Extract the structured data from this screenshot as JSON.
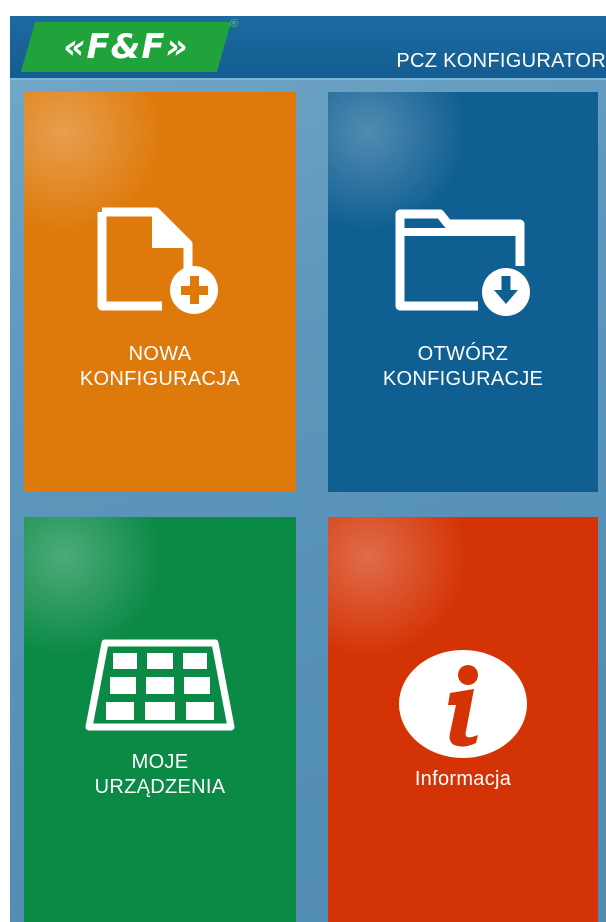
{
  "header": {
    "logo_text": "«F&F»",
    "logo_registered": "®",
    "title": "PCZ KONFIGURATOR"
  },
  "tiles": [
    {
      "id": "new",
      "line1": "NOWA",
      "line2": "KONFIGURACJA",
      "color": "#de7a0b",
      "icon": "new-file-icon"
    },
    {
      "id": "open",
      "line1": "OTWÓRZ",
      "line2": "KONFIGURACJE",
      "color": "#0f5f93",
      "icon": "folder-download-icon"
    },
    {
      "id": "devices",
      "line1": "MOJE",
      "line2": "URZĄDZENIA",
      "color": "#0a8a45",
      "icon": "device-grid-icon"
    },
    {
      "id": "info",
      "line1": "Informacja",
      "color": "#d43405",
      "icon": "info-icon"
    }
  ],
  "colors": {
    "header_bg": "#135d92",
    "background": "#5d97bc",
    "logo_green": "#1fa33a"
  }
}
